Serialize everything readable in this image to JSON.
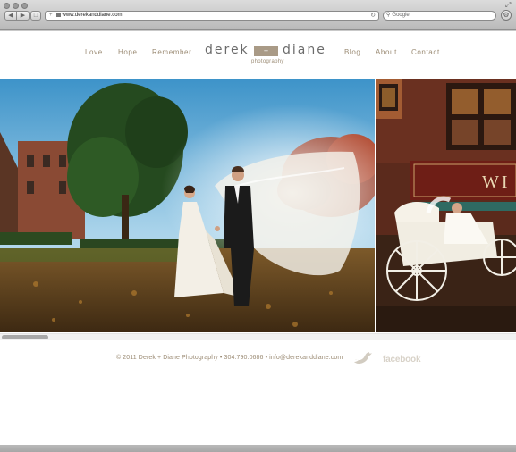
{
  "browser": {
    "url": "www.derekanddiane.com",
    "search_placeholder": "Google"
  },
  "nav": {
    "items": [
      "Love",
      "Hope",
      "Remember",
      "Blog",
      "About",
      "Contact"
    ]
  },
  "logo": {
    "left": "derek",
    "mark": "+",
    "right": "diane",
    "sub": "photography"
  },
  "gallery": {
    "photo1": "bride and groom with flowing veil in autumn park",
    "photo2": "bride in white horse-drawn carriage",
    "sign_text": "WI"
  },
  "footer": {
    "text": "© 2011 Derek + Diane Photography • 304.790.0686 • info@derekanddiane.com",
    "facebook": "facebook"
  },
  "colors": {
    "accent": "#9b8b74",
    "logo_box": "#a99a86"
  }
}
